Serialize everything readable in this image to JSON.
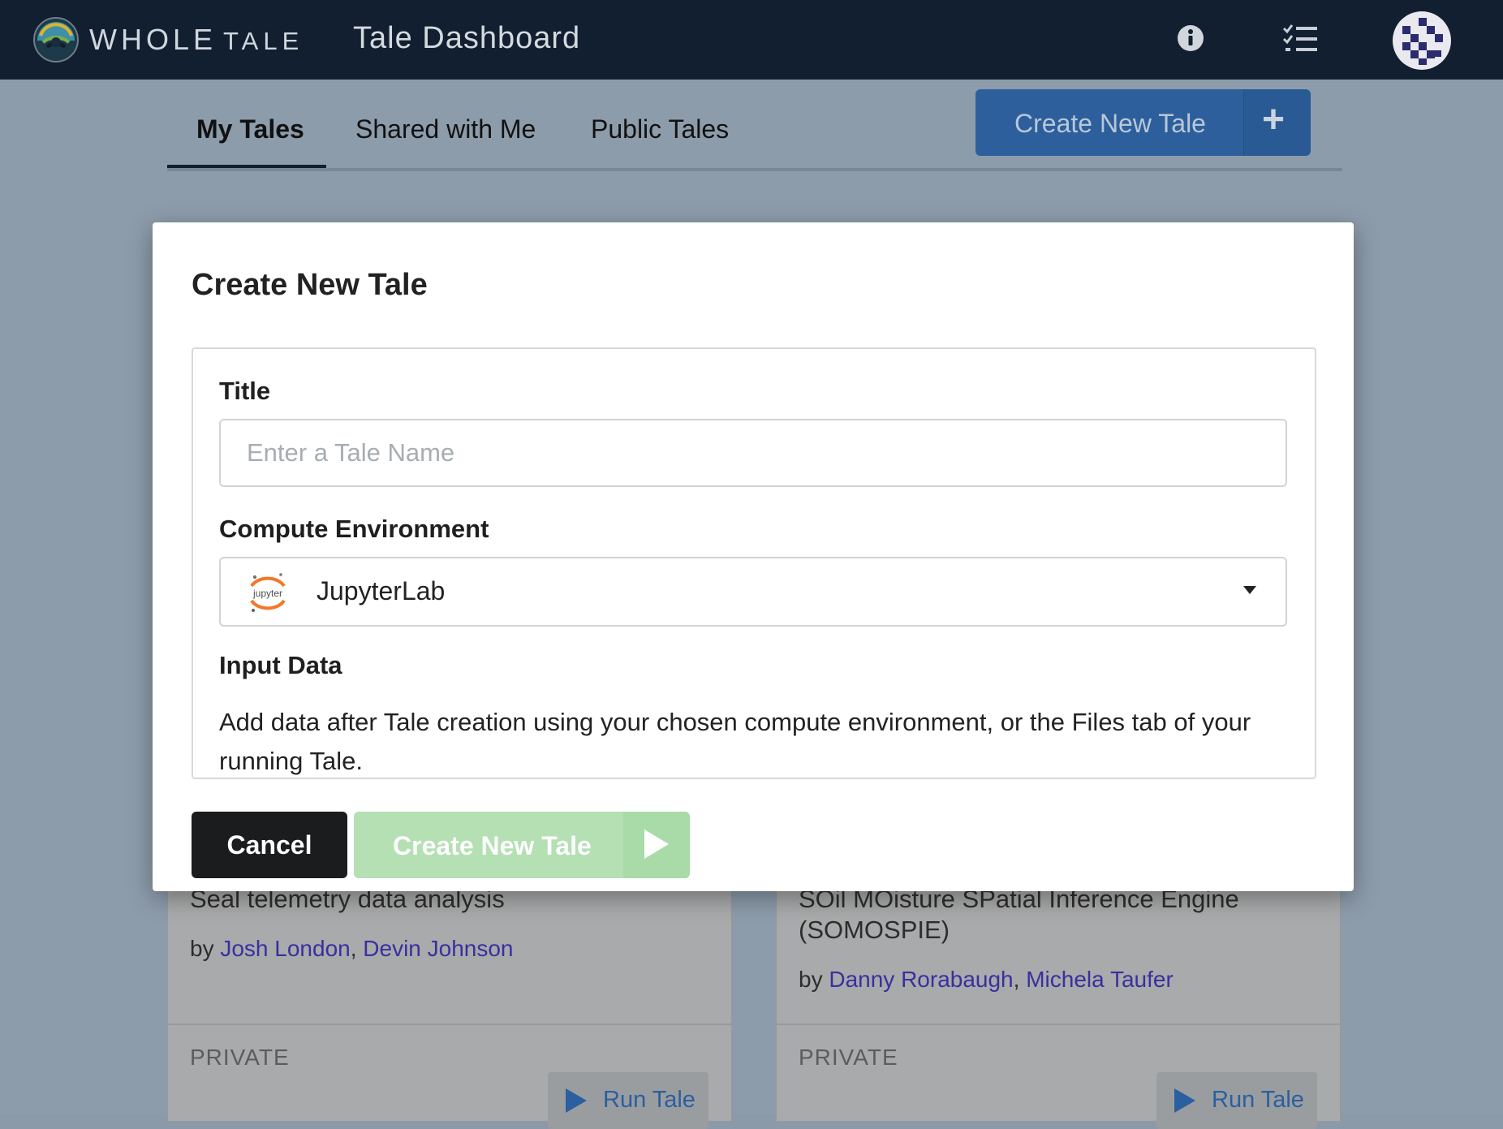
{
  "topnav": {
    "brand_whole": "WHOLE",
    "brand_tale": "TALE",
    "page_title": "Tale Dashboard",
    "icons": [
      "info-icon",
      "tasks-list-icon",
      "user-avatar"
    ]
  },
  "tabs": [
    {
      "label": "My Tales",
      "active": true
    },
    {
      "label": "Shared with Me",
      "active": false
    },
    {
      "label": "Public Tales",
      "active": false
    }
  ],
  "create_button": {
    "label": "Create New Tale",
    "icon": "plus-icon"
  },
  "cards": [
    {
      "title": "Seal telemetry data analysis",
      "by": "by",
      "authors": [
        "Josh London",
        "Devin Johnson"
      ],
      "visibility": "PRIVATE",
      "run_label": "Run Tale"
    },
    {
      "title": "SOil MOisture SPatial Inference Engine (SOMOSPIE)",
      "by": "by",
      "authors": [
        "Danny Rorabaugh",
        "Michela Taufer"
      ],
      "visibility": "PRIVATE",
      "run_label": "Run Tale"
    }
  ],
  "modal": {
    "title": "Create New Tale",
    "title_label": "Title",
    "title_placeholder": "Enter a Tale Name",
    "title_value": "",
    "env_label": "Compute Environment",
    "env_icon_text": "jupyter",
    "env_value": "JupyterLab",
    "input_label": "Input Data",
    "input_desc": "Add data after Tale creation using your chosen compute environment, or the Files tab of your running Tale.",
    "cancel_label": "Cancel",
    "create_label": "Create New Tale"
  },
  "colors": {
    "nav_bg": "#121f30",
    "primary_blue": "#2c5f9c",
    "create_green_disabled": "#b4e0b4",
    "cancel_black": "#1b1c1d",
    "author_link": "#3a2fa0"
  }
}
